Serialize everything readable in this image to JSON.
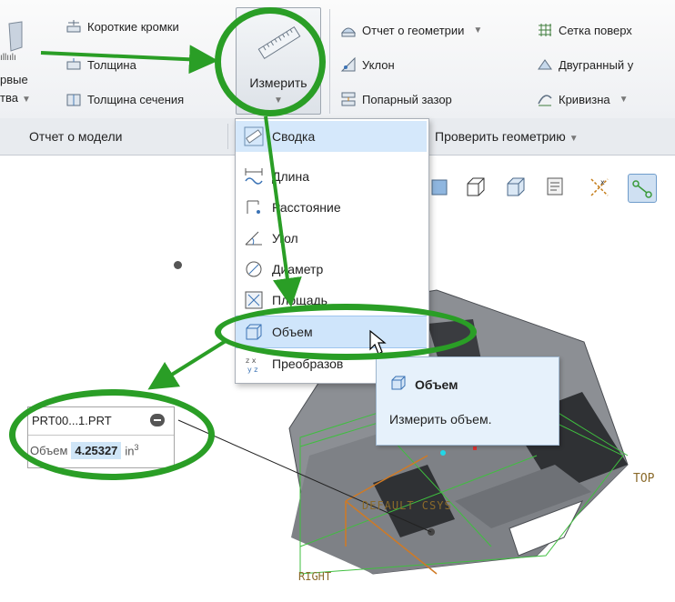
{
  "ribbon": {
    "left_partial_top": "ıllıılı",
    "left_partial_1": "рвые",
    "left_partial_2": "тва",
    "short_edges": "Короткие кромки",
    "thickness": "Толщина",
    "section_thickness": "Толщина сечения",
    "measure": "Измерить",
    "geometry_report": "Отчет о геометрии",
    "slope": "Уклон",
    "pairwise_gap": "Попарный зазор",
    "surface_mesh": "Сетка поверх",
    "dihedral": "Двугранный у",
    "curvature": "Кривизна"
  },
  "group_bar": {
    "model_report": "Отчет о модели",
    "check_geometry": "Проверить геометрию"
  },
  "measure_menu": {
    "items": [
      {
        "label": "Сводка",
        "icon": "summary-icon"
      },
      {
        "label": "Длина",
        "icon": "length-icon"
      },
      {
        "label": "Расстояние",
        "icon": "distance-icon"
      },
      {
        "label": "Угол",
        "icon": "angle-icon"
      },
      {
        "label": "Диаметр",
        "icon": "diameter-icon"
      },
      {
        "label": "Площадь",
        "icon": "area-icon"
      },
      {
        "label": "Объем",
        "icon": "volume-icon"
      },
      {
        "label": "Преобразов",
        "icon": "transform-icon"
      }
    ]
  },
  "tooltip": {
    "title": "Объем",
    "description": "Измерить объем."
  },
  "result": {
    "file": "PRT00...1.PRT",
    "label": "Объем",
    "value": "4.25327",
    "unit": "in",
    "unit_exp": "3"
  },
  "model": {
    "label_top": "TOP",
    "label_csys": "DEFAULT CSYS",
    "label_right": "RIGHT"
  },
  "colors": {
    "annotation_green": "#2a9e26",
    "model_gray": "#8a8d92",
    "selection_blue": "#cfe5fb"
  }
}
